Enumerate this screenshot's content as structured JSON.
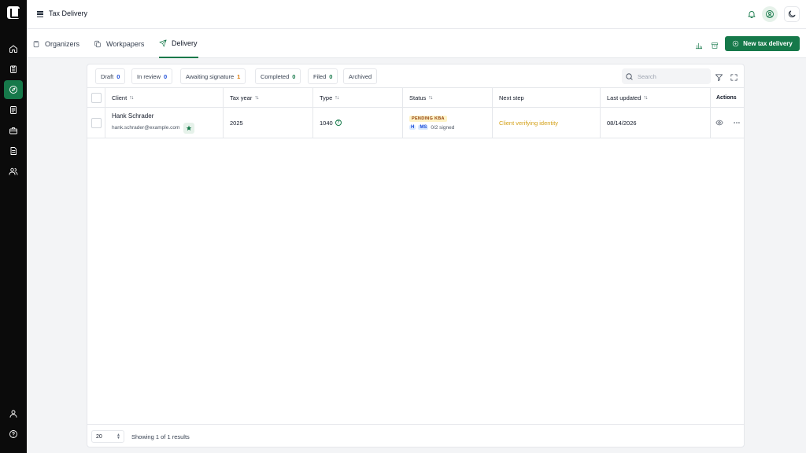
{
  "app": {
    "title": "Tax Delivery"
  },
  "nav": {
    "items": [
      {
        "name": "home",
        "icon": "home-icon"
      },
      {
        "name": "clipboard",
        "icon": "clipboard-icon"
      },
      {
        "name": "delivery",
        "icon": "compass-icon",
        "active": true
      },
      {
        "name": "documents",
        "icon": "document-icon"
      },
      {
        "name": "briefcase",
        "icon": "briefcase-icon"
      },
      {
        "name": "reports",
        "icon": "file-text-icon"
      },
      {
        "name": "users",
        "icon": "users-icon"
      },
      {
        "name": "profile",
        "icon": "user-icon"
      },
      {
        "name": "help",
        "icon": "help-icon"
      }
    ]
  },
  "tabs": [
    {
      "label": "Organizers",
      "active": false
    },
    {
      "label": "Workpapers",
      "active": false
    },
    {
      "label": "Delivery",
      "active": true
    }
  ],
  "actions": {
    "new_button": "New tax delivery"
  },
  "filters": [
    {
      "label": "Draft",
      "count": "0"
    },
    {
      "label": "In review",
      "count": "0"
    },
    {
      "label": "Awaiting signature",
      "count": "1"
    },
    {
      "label": "Completed",
      "count": "0"
    },
    {
      "label": "Filed",
      "count": "0"
    },
    {
      "label": "Archived",
      "count": ""
    }
  ],
  "search": {
    "placeholder": "Search"
  },
  "table": {
    "headers": {
      "client": "Client",
      "tax_year": "Tax year",
      "type": "Type",
      "status": "Status",
      "next_step": "Next step",
      "last_updated": "Last updated",
      "actions": "Actions"
    },
    "rows": [
      {
        "client_name": "Hank Schrader",
        "client_email": "hank.schrader@example.com",
        "tax_year": "2025",
        "type": "1040",
        "status_badge": "PENDING KBA",
        "signer_initials": "H",
        "signer_initials_2": "MS",
        "signed": "0/2 signed",
        "next_step": "Client verifying identity",
        "last_updated": "08/14/2026"
      }
    ]
  },
  "footer": {
    "page_size": "20",
    "showing": "Showing 1 of 1 results"
  },
  "colors": {
    "accent": "#16794a",
    "rail": "#0b0b0b",
    "warning": "#d4a017"
  }
}
